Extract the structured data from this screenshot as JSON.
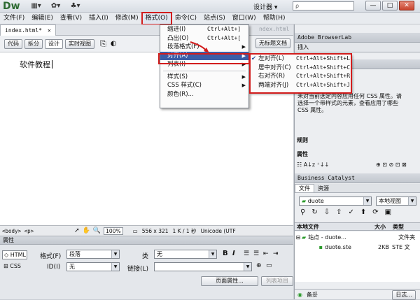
{
  "titlebar": {
    "logo": "Dw",
    "designer": "设计器",
    "search_placeholder": "ρ"
  },
  "menu": [
    "文件(F)",
    "编辑(E)",
    "查看(V)",
    "插入(I)",
    "修改(M)",
    "格式(O)",
    "命令(C)",
    "站点(S)",
    "窗口(W)",
    "帮助(H)"
  ],
  "doc": {
    "tab": "index.html*",
    "tab2": "ndex.html",
    "views": [
      "代码",
      "拆分",
      "设计",
      "实时视图"
    ],
    "untitled": "无标题文档",
    "body_text": "软件教程"
  },
  "format_menu": [
    {
      "label": "缩进(I)",
      "shortcut": "Ctrl+Alt+]"
    },
    {
      "label": "凸出(O)",
      "shortcut": "Ctrl+Alt+["
    },
    {
      "label": "段落格式(F)",
      "shortcut": ""
    },
    {
      "label": "对齐(A)",
      "shortcut": ""
    },
    {
      "label": "列表(I)",
      "shortcut": ""
    },
    {
      "label": "样式(S)",
      "shortcut": ""
    },
    {
      "label": "CSS 样式(C)",
      "shortcut": ""
    },
    {
      "label": "颜色(R)...",
      "shortcut": ""
    }
  ],
  "align_menu": [
    {
      "label": "左对齐(L)",
      "shortcut": "Ctrl+Alt+Shift+L",
      "checked": true
    },
    {
      "label": "居中对齐(C)",
      "shortcut": "Ctrl+Alt+Shift+C",
      "checked": false
    },
    {
      "label": "右对齐(R)",
      "shortcut": "Ctrl+Alt+Shift+R",
      "checked": false
    },
    {
      "label": "两端对齐(J)",
      "shortcut": "Ctrl+Alt+Shift+J",
      "checked": false
    }
  ],
  "status": {
    "tags": "<body> <p>",
    "zoom": "100%",
    "size": "556 x 321",
    "weight": "1 K / 1 秒",
    "encoding": "Unicode (UTF"
  },
  "props": {
    "title": "属性",
    "html_btn": "HTML",
    "css_btn": "CSS",
    "format_label": "格式(F)",
    "format_value": "段落",
    "class_label": "类",
    "class_value": "无",
    "id_label": "ID(I)",
    "id_value": "无",
    "link_label": "链接(L)",
    "page_props": "页面属性...",
    "list_item": "列表项目"
  },
  "right": {
    "browserlab": "Adobe BrowserLab",
    "insert": "插入",
    "css_hint": "未对当前选定内容应用任何 CSS 属性。请选择一个带样式的元素，查看应用了哪些 CSS 属性。",
    "rules": "规则",
    "attrs": "属性",
    "catalyst": "Business Catalyst",
    "files_tab": "文件",
    "assets_tab": "资源",
    "site": "duote",
    "view": "本地视图",
    "col_local": "本地文件",
    "col_size": "大小",
    "col_type": "类型",
    "site_row": "站点 - duote...",
    "site_type": "文件夹",
    "file_row": "duote.ste",
    "file_size": "2KB",
    "file_type": "STE 文",
    "ready": "备妥",
    "log": "日志..."
  }
}
